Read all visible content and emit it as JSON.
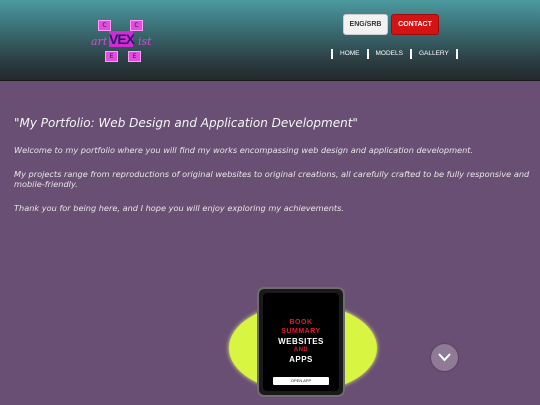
{
  "header": {
    "logo": {
      "squares": [
        "C",
        "C",
        "E",
        "E"
      ],
      "left_text": "art",
      "mark": "VEX",
      "right_text": "ist"
    },
    "lang_button": "ENG/SRB",
    "contact_button": "CONTACT",
    "nav": [
      "HOME",
      "MODELS",
      "GALLERY"
    ]
  },
  "main": {
    "title": "\"My Portfolio: Web Design and Application Development\"",
    "paragraphs": [
      "Welcome to my portfolio where you will find my works encompassing web design and application development.",
      "My projects range from reproductions of original websites to original creations, all carefully crafted to be fully responsive and mobile-friendly.",
      "Thank you for being here, and I hope you will enjoy exploring my achievements."
    ]
  },
  "promo": {
    "line1": "BOOK",
    "line2": "SUMMARY",
    "line3": "WEBSITES",
    "line4": "AND",
    "line5": "APPS",
    "button": "OPEN APP"
  },
  "icons": {
    "scroll": "chevron-down-icon"
  },
  "colors": {
    "accent": "#d41414",
    "highlight": "#d7f541",
    "background": "#6a4f74"
  }
}
